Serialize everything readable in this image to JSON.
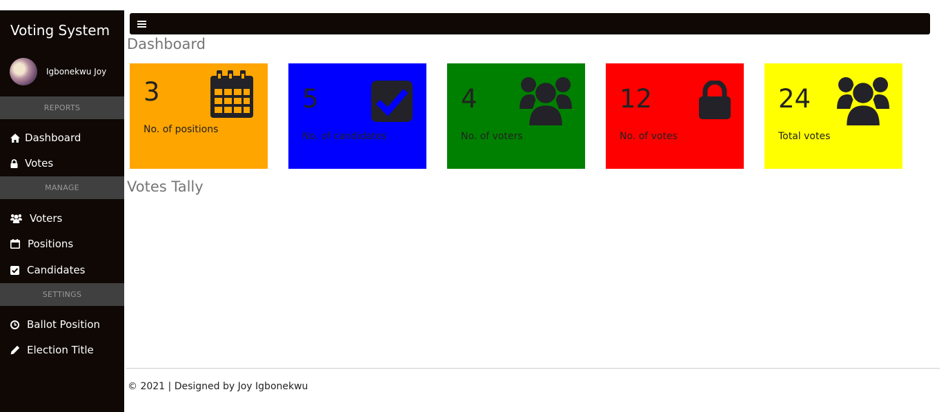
{
  "sidebar": {
    "brand": "Voting System",
    "user_name": "Igbonekwu Joy",
    "sections": {
      "reports": "REPORTS",
      "manage": "MANAGE",
      "settings": "SETTINGS"
    },
    "items": {
      "dashboard": "Dashboard",
      "votes": "Votes",
      "voters": "Voters",
      "positions": "Positions",
      "candidates": "Candidates",
      "ballot_position": "Ballot Position",
      "election_title": "Election Title"
    }
  },
  "main": {
    "dashboard_title": "Dashboard",
    "tally_title": "Votes Tally",
    "cards": [
      {
        "value": "3",
        "label": "No. of positions",
        "color": "#ffa500",
        "icon": "calendar-icon"
      },
      {
        "value": "5",
        "label": "No. of candidates",
        "color": "#0000ff",
        "icon": "check-square-icon"
      },
      {
        "value": "4",
        "label": "No. of voters",
        "color": "#008000",
        "icon": "users-icon"
      },
      {
        "value": "12",
        "label": "No. of votes",
        "color": "#ff0000",
        "icon": "lock-icon"
      },
      {
        "value": "24",
        "label": "Total votes",
        "color": "#ffff00",
        "icon": "users-icon"
      }
    ]
  },
  "footer": {
    "text": "© 2021 | Designed by Joy Igbonekwu"
  }
}
